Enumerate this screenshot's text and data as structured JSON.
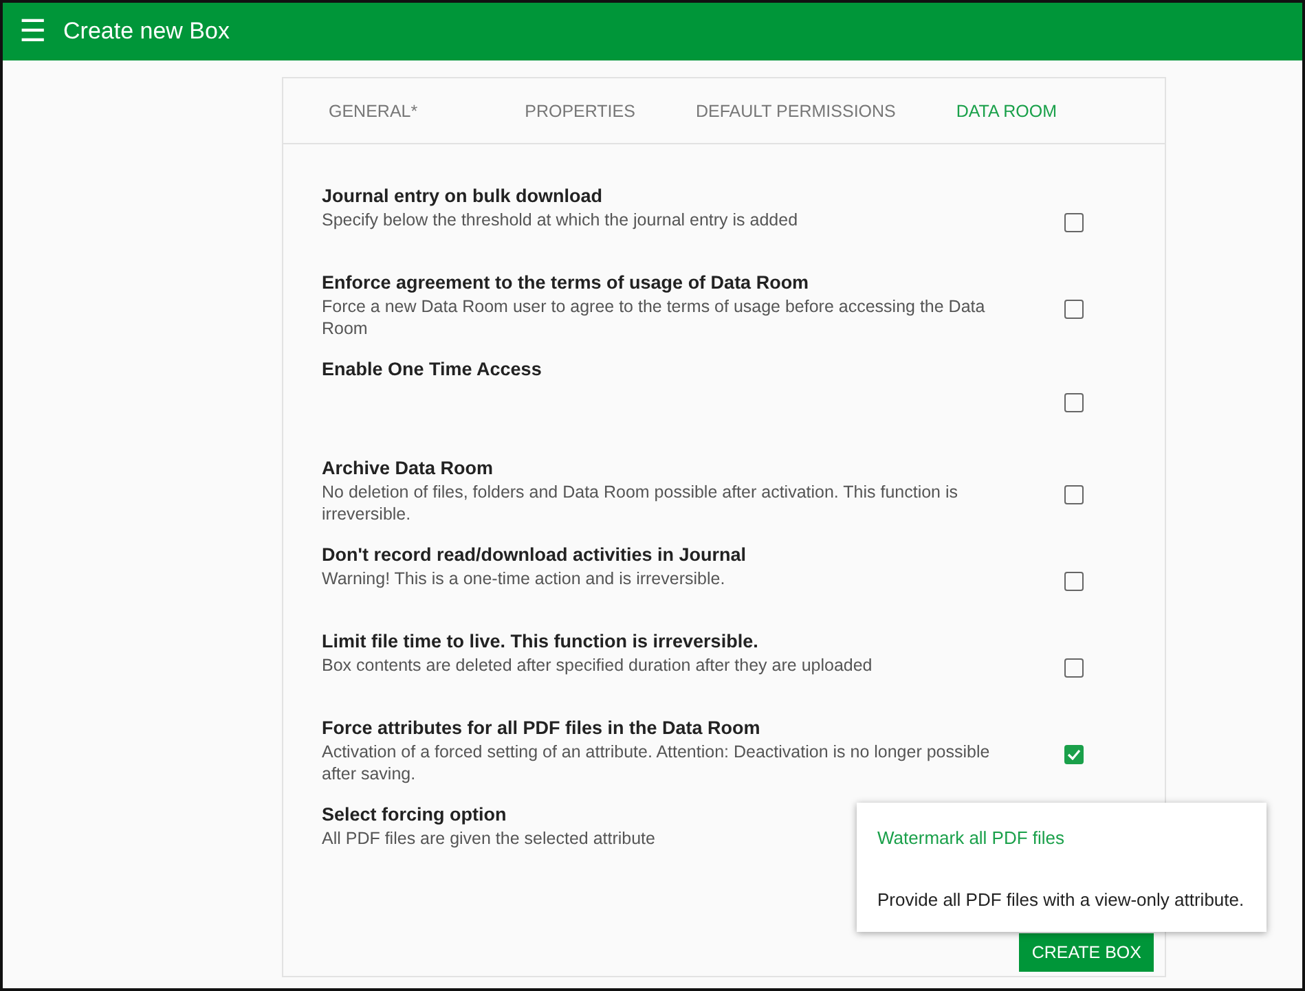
{
  "app_bar": {
    "menu_icon": "☰",
    "title": "Create new Box"
  },
  "tabs": [
    {
      "label": "GENERAL*",
      "selected": false
    },
    {
      "label": "PROPERTIES",
      "selected": false
    },
    {
      "label": "DEFAULT PERMISSIONS",
      "selected": false
    },
    {
      "label": "DATA ROOM",
      "selected": true
    }
  ],
  "settings": [
    {
      "kind": "checkbox",
      "title": "Journal entry on bulk download",
      "description": "Specify below the threshold at which the journal entry is added",
      "checked": false
    },
    {
      "kind": "checkbox",
      "title": "Enforce agreement to the terms of usage of Data Room",
      "description": "Force a new Data Room user to agree to the terms of usage before accessing the Data Room",
      "checked": false
    },
    {
      "kind": "checkbox",
      "title": "Enable One Time Access",
      "checked": false
    },
    {
      "kind": "checkbox",
      "title": "Archive Data Room",
      "description": "No deletion of files, folders and Data Room possible after activation. This function is irreversible.",
      "checked": false
    },
    {
      "kind": "checkbox",
      "title": "Don't record read/download activities in Journal",
      "description": "Warning! This is a one-time action and is irreversible.",
      "checked": false
    },
    {
      "kind": "checkbox",
      "title": "Limit file time to live. This function is irreversible.",
      "description": "Box contents are deleted after specified duration after they are uploaded",
      "checked": false
    },
    {
      "kind": "checkbox",
      "title": "Force attributes for all PDF files in the Data Room",
      "description": "Activation of a forced setting of an attribute. Attention: Deactivation is no longer possible after saving.",
      "checked": true
    },
    {
      "kind": "select",
      "title": "Select forcing option",
      "description": "All PDF files are given the selected attribute"
    }
  ],
  "dropdown_menu": [
    {
      "label": "Watermark all PDF files",
      "selected": true
    },
    {
      "label": "Provide all PDF files with a view-only attribute.",
      "selected": false
    }
  ],
  "create_button": "CREATE BOX"
}
